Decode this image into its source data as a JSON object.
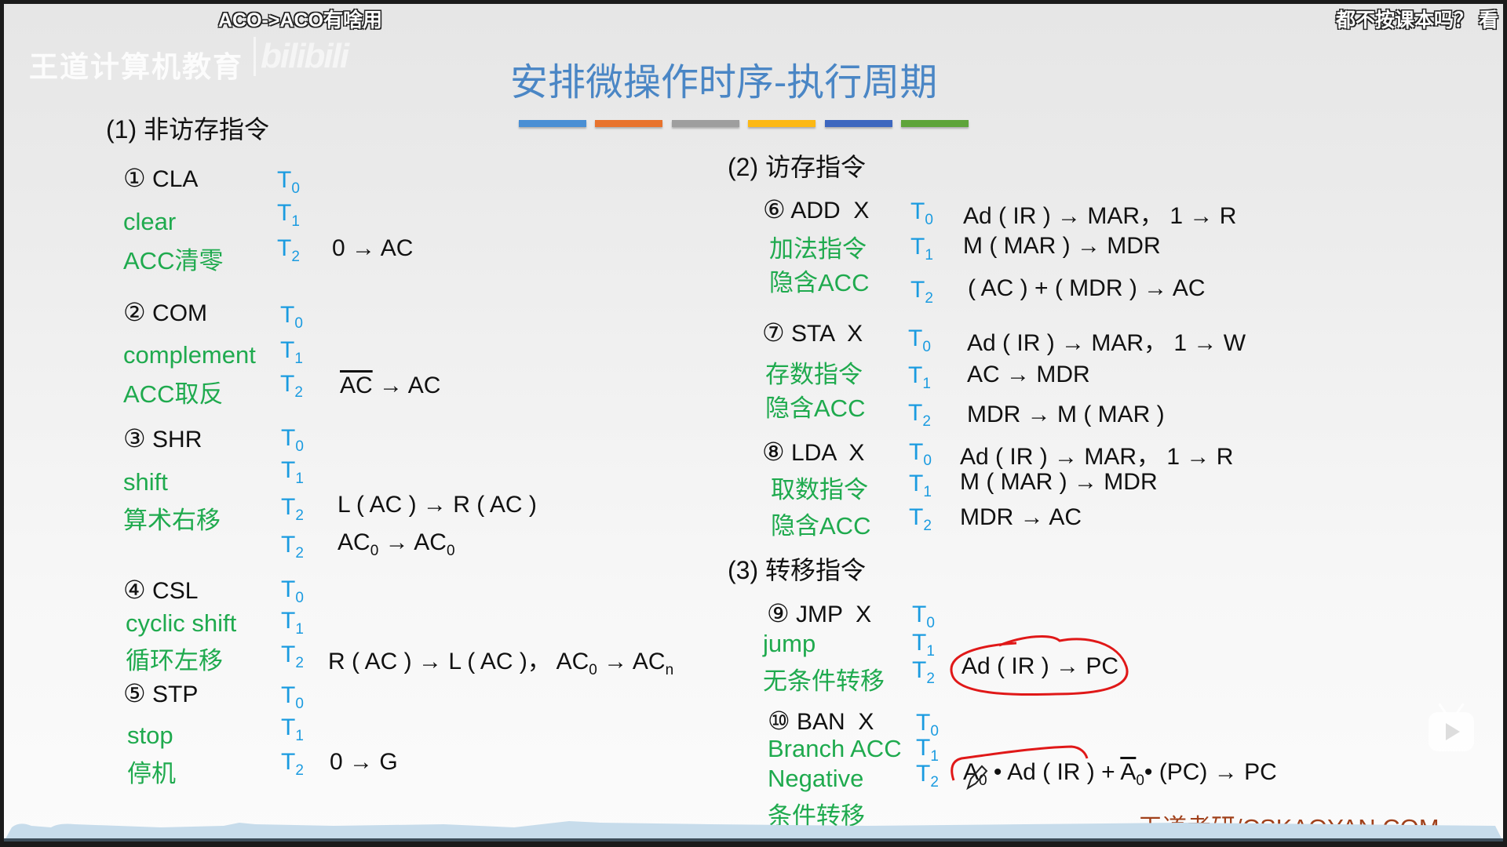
{
  "overlay": {
    "danmaku_1": "ACO->ACO有啥用",
    "danmaku_2": "都不按课本吗？ 看",
    "watermark": "王道计算机教育",
    "bilibili_logo": "bilibili"
  },
  "slide": {
    "title": "安排微操作时序-执行周期",
    "bar_colors": [
      "#4a8fd4",
      "#e8732d",
      "#9e9e9e",
      "#fcb814",
      "#3d67bf",
      "#5ea43a"
    ],
    "footer_brand": "王道考研/CSKAOYAN.COM",
    "sections": [
      {
        "label": "(1) 非访存指令"
      },
      {
        "label": "(2) 访存指令"
      },
      {
        "label": "(3) 转移指令"
      }
    ],
    "instructions": [
      {
        "num": "①",
        "name": "CLA",
        "desc": [
          "clear",
          "ACC清零"
        ],
        "t": [
          "T",
          "T",
          "T"
        ],
        "sub": [
          "0",
          "1",
          "2"
        ],
        "ops": [
          "",
          "",
          "0 → AC"
        ]
      },
      {
        "num": "②",
        "name": "COM",
        "desc": [
          "complement",
          "ACC取反"
        ],
        "ops": [
          "",
          "",
          "→ AC"
        ],
        "overline_operand": "AC"
      },
      {
        "num": "③",
        "name": "SHR",
        "desc": [
          "shift",
          "算术右移"
        ],
        "ops": [
          "",
          "",
          "L ( AC ) → R ( AC )",
          "AC0 → AC0"
        ]
      },
      {
        "num": "④",
        "name": "CSL",
        "desc": [
          "cyclic shift",
          "循环左移"
        ],
        "ops": [
          "",
          "",
          "R ( AC ) → L ( AC )， AC0 → ACn"
        ]
      },
      {
        "num": "⑤",
        "name": "STP",
        "desc": [
          "stop",
          "停机"
        ],
        "ops": [
          "",
          "",
          "0 → G"
        ]
      },
      {
        "num": "⑥",
        "name": "ADD  X",
        "desc": [
          "加法指令",
          "隐含ACC"
        ],
        "ops": [
          "Ad ( IR ) → MAR， 1 → R",
          "M ( MAR ) → MDR",
          "( AC ) + ( MDR ) → AC"
        ]
      },
      {
        "num": "⑦",
        "name": "STA  X",
        "desc": [
          "存数指令",
          "隐含ACC"
        ],
        "ops": [
          "Ad ( IR ) → MAR， 1 → W",
          "AC → MDR",
          "MDR → M ( MAR )"
        ]
      },
      {
        "num": "⑧",
        "name": "LDA  X",
        "desc": [
          "取数指令",
          "隐含ACC"
        ],
        "ops": [
          "Ad ( IR ) → MAR， 1 → R",
          "M ( MAR ) → MDR",
          "MDR → AC"
        ]
      },
      {
        "num": "⑨",
        "name": "JMP  X",
        "desc": [
          "jump",
          "无条件转移"
        ],
        "ops": [
          "",
          "",
          "Ad ( IR ) → PC"
        ]
      },
      {
        "num": "⑩",
        "name": "BAN  X",
        "desc": [
          "Branch ACC",
          "Negative",
          "条件转移"
        ],
        "ops": [
          "",
          "",
          "A0 • Ad ( IR ) + A0• (PC) → PC"
        ]
      }
    ],
    "t_label": "T",
    "t_subs": [
      "0",
      "1",
      "2"
    ],
    "arrow": "→",
    "sym": {
      "lparen": "(",
      "rparen": ")",
      "ac": "AC",
      "pc": "PC",
      "dot": "•",
      "plus": "+",
      "ad_ir_to_pc": "Ad ( IR ) → PC",
      "l_ac_r_ac": "L ( AC ) → R ( AC )",
      "r_ac_l_ac": "R ( AC ) → L ( AC )，",
      "a": "A",
      "zero": "0",
      "n": "n",
      "ban_mid": " • Ad ( IR ) + ",
      "ban_end": "• (PC) → PC"
    }
  }
}
